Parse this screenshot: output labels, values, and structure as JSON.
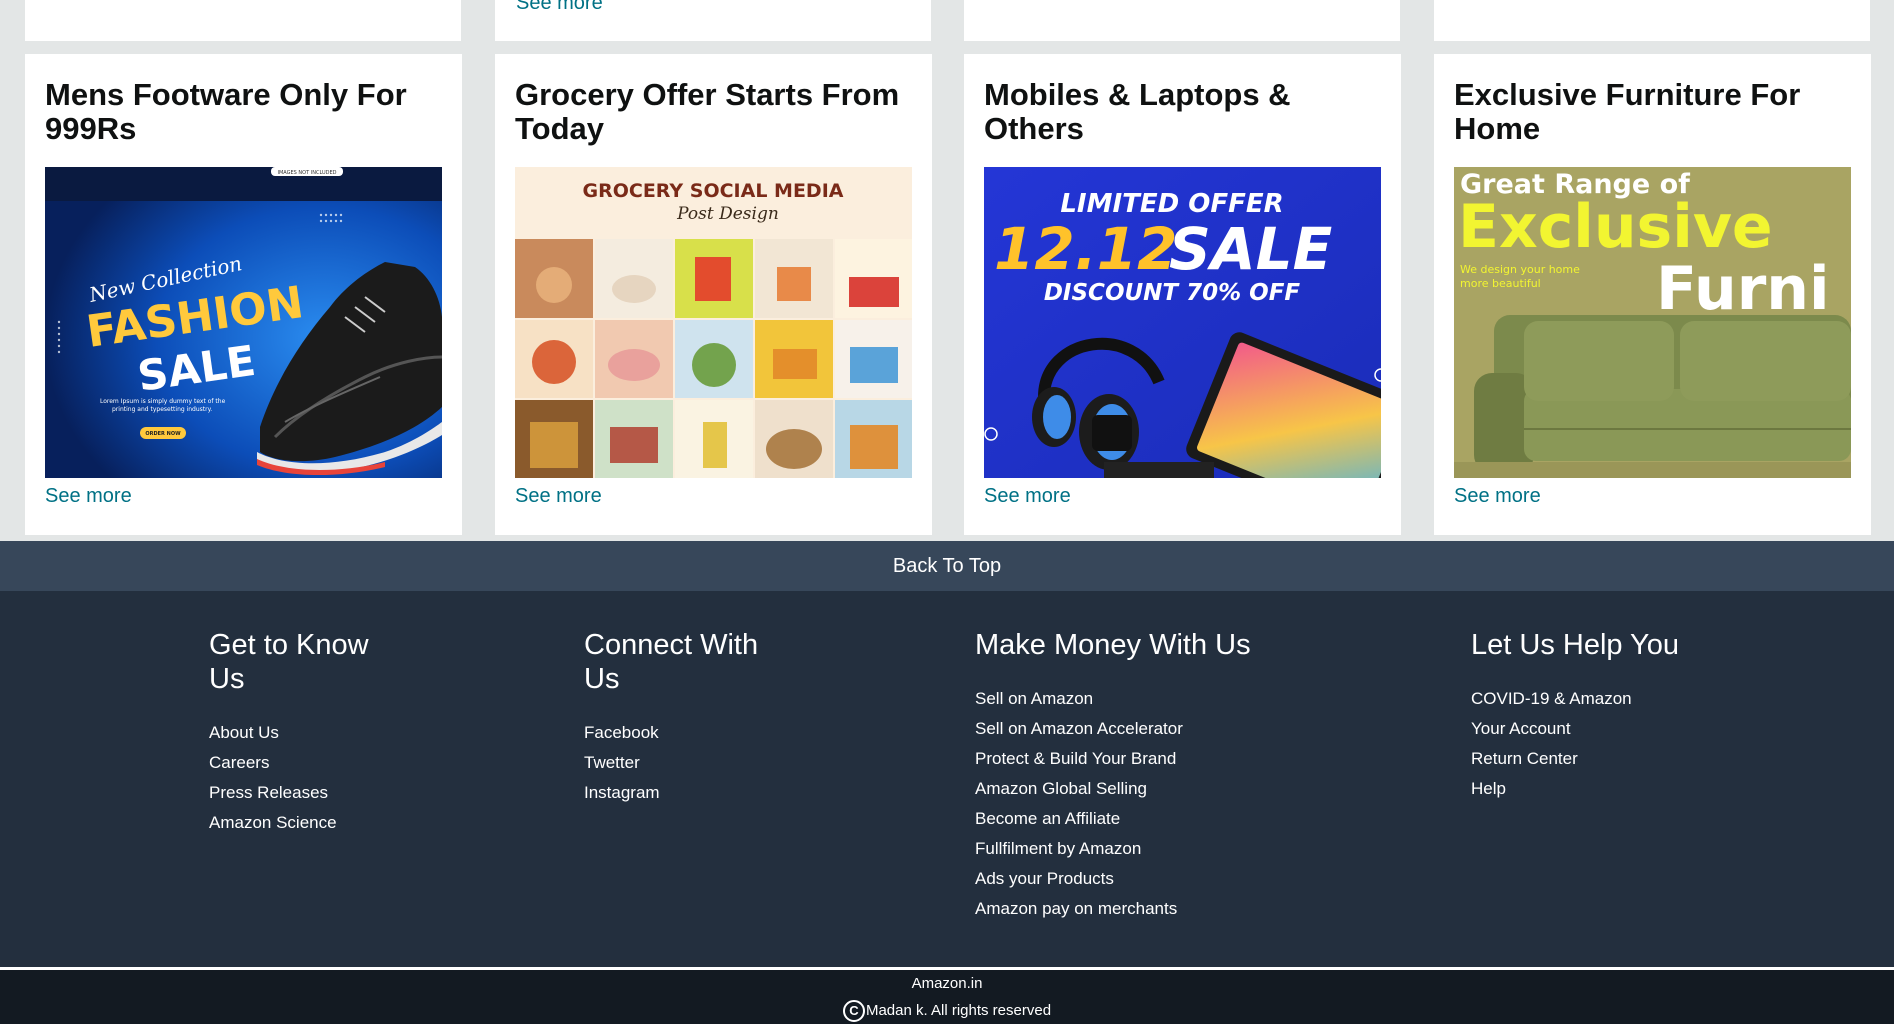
{
  "top_row": {
    "see_more": "See more"
  },
  "cards": [
    {
      "title": "Mens Footware Only For 999Rs",
      "see_more": "See more",
      "image": {
        "tag": "IMAGES NOT INCLUDED",
        "line1": "New Collection",
        "line2": "FASHION",
        "line3": "SALE",
        "body": "Lorem Ipsum is simply dummy text of the printing and typesetting industry.",
        "button": "ORDER NOW"
      }
    },
    {
      "title": "Grocery Offer Starts From Today",
      "see_more": "See more",
      "image": {
        "heading": "GROCERY SOCIAL MEDIA",
        "script": "Post Design"
      }
    },
    {
      "title": "Mobiles & Laptops & Others",
      "see_more": "See more",
      "image": {
        "line1": "LIMITED OFFER",
        "line2": "12.12",
        "line3": "SALE",
        "line4": "DISCOUNT 70% OFF"
      }
    },
    {
      "title": "Exclusive Furniture For Home",
      "see_more": "See more",
      "image": {
        "line1": "Great Range of",
        "line2": "Exclusive",
        "line3": "Furni",
        "sub1": "We design your home",
        "sub2": "more beautiful"
      }
    }
  ],
  "back_to_top": "Back To Top",
  "footer": {
    "columns": [
      {
        "title_l1": "Get to Know",
        "title_l2": "Us",
        "links": [
          "About Us",
          "Careers",
          "Press Releases",
          "Amazon Science"
        ]
      },
      {
        "title_l1": "Connect With",
        "title_l2": "Us",
        "links": [
          "Facebook",
          "Twetter",
          "Instagram"
        ]
      },
      {
        "title_l1": "Make Money With Us",
        "title_l2": "",
        "links": [
          "Sell on Amazon",
          "Sell on Amazon Accelerator",
          "Protect & Build Your Brand",
          "Amazon Global Selling",
          "Become an Affiliate",
          "Fullfilment by Amazon",
          "Ads your Products",
          "Amazon pay on merchants"
        ]
      },
      {
        "title_l1": "Let Us Help You",
        "title_l2": "",
        "links": [
          "COVID-19 & Amazon",
          "Your Account",
          "Return Center",
          "Help"
        ]
      }
    ],
    "site": "Amazon.in",
    "copyright_symbol": "C",
    "copyright": "Madan k. All rights reserved"
  },
  "colors": {
    "link": "#007185",
    "footer_bg": "#232f3e",
    "back_top_bg": "#37475a",
    "bottom_bg": "#131a22",
    "page_bg": "#e3e6e6"
  }
}
